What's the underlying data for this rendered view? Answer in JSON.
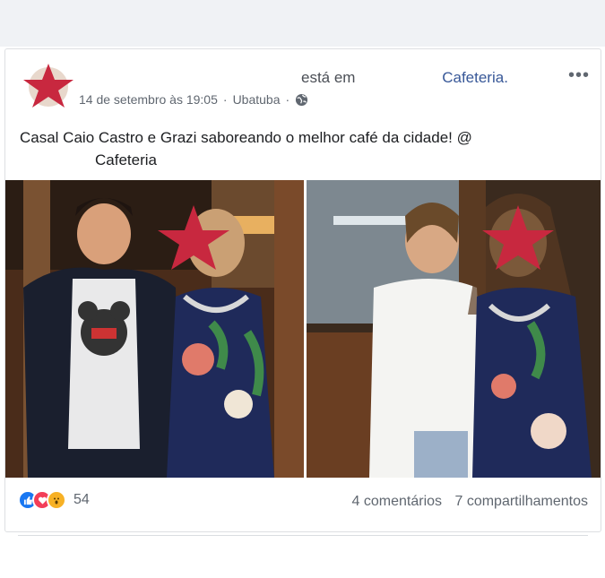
{
  "post": {
    "action_text": "está em",
    "place": "Cafeteria.",
    "timestamp": "14 de setembro às 19:05",
    "location": "Ubatuba",
    "separator": "·",
    "text_line1": "Casal Caio Castro e Grazi saboreando o melhor café da cidade! @",
    "text_line2": "Cafeteria",
    "more_icon": "•••"
  },
  "footer": {
    "reaction_count": "54",
    "comments": "4 comentários",
    "shares": "7 compartilhamentos"
  },
  "icons": {
    "privacy": "globe-icon",
    "menu": "more-options-icon",
    "reactions": [
      "like-icon",
      "love-icon",
      "wow-icon"
    ]
  },
  "colors": {
    "link": "#385898",
    "star_mask": "#c8283f",
    "meta_text": "#606770"
  }
}
